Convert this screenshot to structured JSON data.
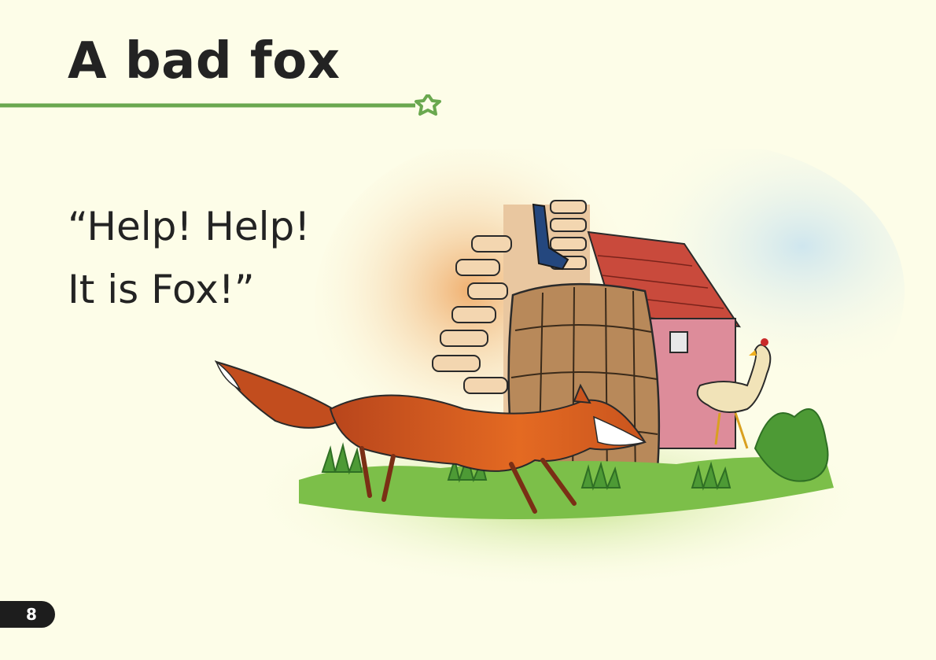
{
  "page": {
    "title": "A bad fox",
    "story_lines": [
      "“Help! Help!",
      "It is Fox!”"
    ],
    "page_number": "8"
  },
  "colors": {
    "background": "#fdfde8",
    "accent_green": "#6aa84f",
    "text": "#232323",
    "page_tab": "#1d1d1d"
  },
  "illustration": {
    "subjects": [
      "fox",
      "hen",
      "barrel",
      "stone-wall",
      "cottage",
      "grass"
    ]
  },
  "icons": [
    "star-icon"
  ]
}
